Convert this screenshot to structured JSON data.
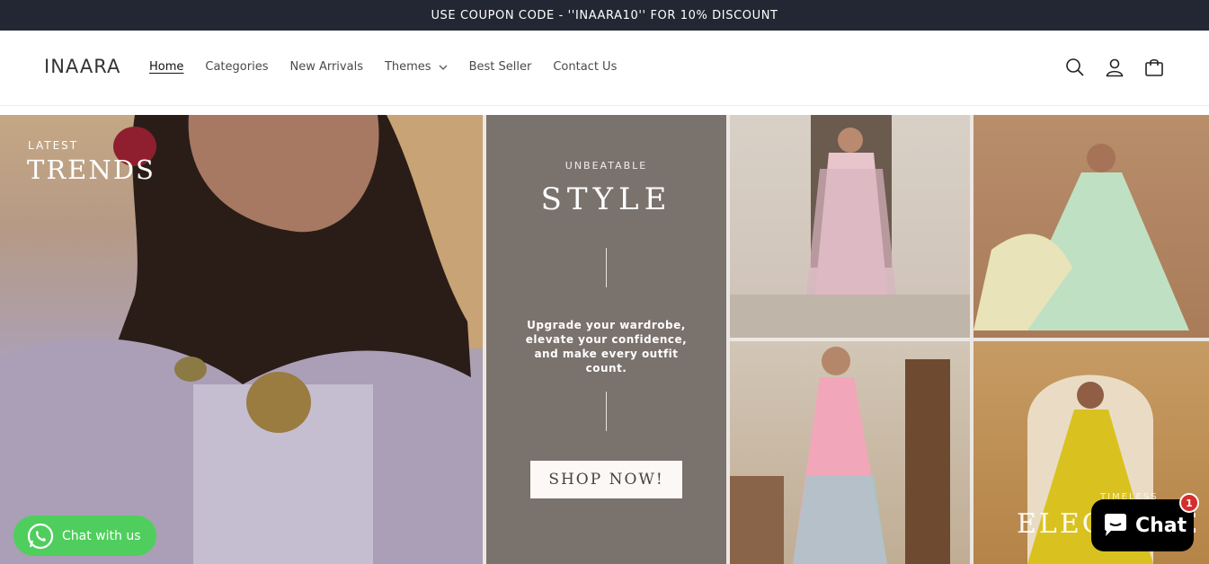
{
  "announcement": "USE COUPON CODE - ''INAARA10'' FOR 10% DISCOUNT",
  "header": {
    "logo": "INAARA",
    "nav": [
      {
        "label": "Home"
      },
      {
        "label": "Categories"
      },
      {
        "label": "New Arrivals"
      },
      {
        "label": "Themes"
      },
      {
        "label": "Best Seller"
      },
      {
        "label": "Contact Us"
      }
    ],
    "icons": [
      "search-icon",
      "account-icon",
      "cart-icon"
    ]
  },
  "banner": {
    "left": {
      "kicker": "LATEST",
      "headline": "TRENDS"
    },
    "center": {
      "kicker": "UNBEATABLE",
      "headline": "STYLE",
      "copy": "Upgrade your wardrobe, elevate your confidence, and make every outfit count.",
      "cta": "SHOP NOW!"
    },
    "bottom_right": {
      "small": "TIMELESS",
      "headline": "ELEGANCE"
    }
  },
  "widgets": {
    "whatsapp": "Chat with us",
    "chat": "Chat",
    "chat_badge": "1"
  },
  "colors": {
    "announce_bg": "#232733",
    "panel_bg": "#7a726d",
    "whatsapp_green": "#4fce5d",
    "badge_red": "#d62d2d"
  }
}
